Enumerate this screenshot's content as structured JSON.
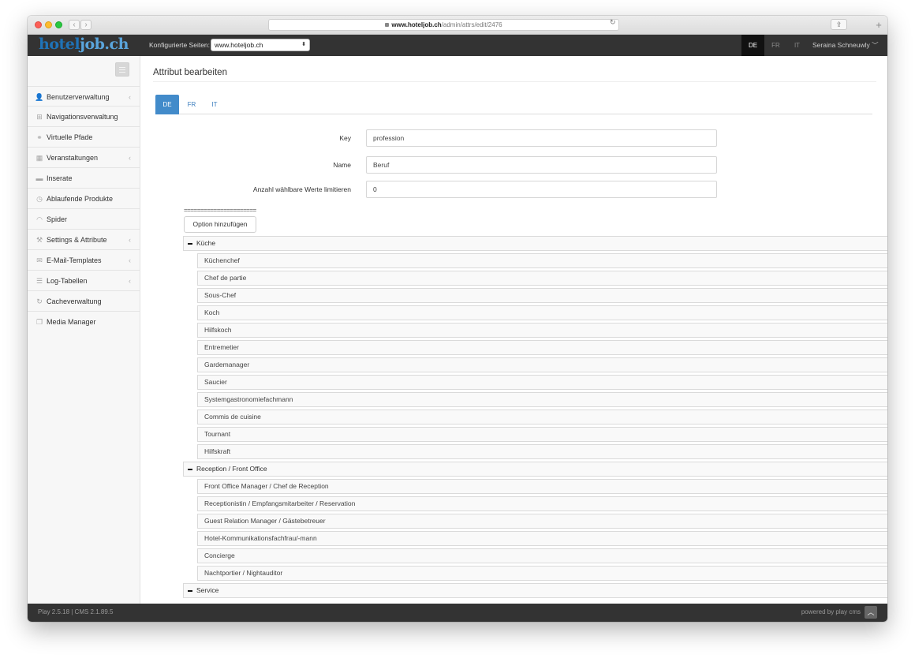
{
  "browser": {
    "url_host": "www.hoteljob.ch",
    "url_path": "/admin/attrs/edit/2476",
    "back_glyph": "‹",
    "forward_glyph": "›",
    "reload_glyph": "↻",
    "share_glyph": "⇪",
    "tabs_glyph": "❐",
    "plus_glyph": "+"
  },
  "header": {
    "logo_main": "hotel",
    "logo_accent": "job.ch",
    "site_label": "Konfigurierte Seiten:",
    "site_value": "www.hoteljob.ch",
    "languages": [
      "DE",
      "FR",
      "IT"
    ],
    "active_language": "DE",
    "user_name": "Seraina Schneuwly",
    "user_caret": "﹀"
  },
  "sidebar": {
    "items": [
      {
        "label": "Benutzerverwaltung",
        "icon": "user-icon",
        "glyph": "👤",
        "chevron": "‹"
      },
      {
        "label": "Navigationsverwaltung",
        "icon": "sitemap-icon",
        "glyph": "⊞",
        "chevron": ""
      },
      {
        "label": "Virtuelle Pfade",
        "icon": "link-icon",
        "glyph": "⚭",
        "chevron": ""
      },
      {
        "label": "Veranstaltungen",
        "icon": "calendar-icon",
        "glyph": "▦",
        "chevron": "‹"
      },
      {
        "label": "Inserate",
        "icon": "bed-icon",
        "glyph": "▬",
        "chevron": ""
      },
      {
        "label": "Ablaufende Produkte",
        "icon": "clock-icon",
        "glyph": "◷",
        "chevron": ""
      },
      {
        "label": "Spider",
        "icon": "rss-icon",
        "glyph": "◠",
        "chevron": ""
      },
      {
        "label": "Settings & Attribute",
        "icon": "wrench-icon",
        "glyph": "⚒",
        "chevron": "‹"
      },
      {
        "label": "E-Mail-Templates",
        "icon": "envelope-icon",
        "glyph": "✉",
        "chevron": "‹"
      },
      {
        "label": "Log-Tabellen",
        "icon": "list-icon",
        "glyph": "☰",
        "chevron": "‹"
      },
      {
        "label": "Cacheverwaltung",
        "icon": "refresh-icon",
        "glyph": "↻",
        "chevron": ""
      },
      {
        "label": "Media Manager",
        "icon": "files-icon",
        "glyph": "❐",
        "chevron": ""
      }
    ]
  },
  "main": {
    "title": "Attribut bearbeiten",
    "tabs": [
      "DE",
      "FR",
      "IT"
    ],
    "active_tab": "DE",
    "fields": {
      "key_label": "Key",
      "key_value": "profession",
      "name_label": "Name",
      "name_value": "Beruf",
      "limit_label": "Anzahl wählbare Werte limitieren",
      "limit_value": "0"
    },
    "separator": "======================",
    "add_option_label": "Option hinzufügen",
    "groups": [
      {
        "label": "Küche",
        "options": [
          "Küchenchef",
          "Chef de partie",
          "Sous-Chef",
          "Koch",
          "Hilfskoch",
          "Entremetier",
          "Gardemanager",
          "Saucier",
          "Systemgastronomiefachmann",
          "Commis de cuisine",
          "Tournant",
          "Hilfskraft"
        ]
      },
      {
        "label": "Reception / Front Office",
        "options": [
          "Front Office Manager / Chef de Reception",
          "Receptionistin / Empfangsmitarbeiter / Reservation",
          "Guest Relation Manager / Gästebetreuer",
          "Hotel-Kommunikationsfachfrau/-mann",
          "Concierge",
          "Nachtportier / Nightauditor"
        ]
      },
      {
        "label": "Service",
        "options": []
      }
    ]
  },
  "footer": {
    "version": "Play 2.5.18 | CMS 2.1.89.5",
    "powered_by": "powered by play cms",
    "scroll_top_glyph": "︿"
  },
  "colors": {
    "accent": "#428bca",
    "topbar": "#333333",
    "logo": "#1f73b7"
  }
}
